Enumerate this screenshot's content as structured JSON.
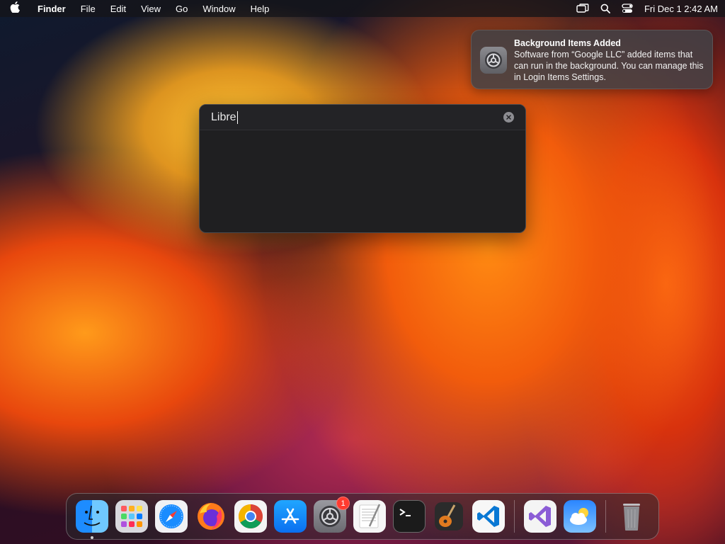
{
  "menubar": {
    "app_name": "Finder",
    "menus": [
      "File",
      "Edit",
      "View",
      "Go",
      "Window",
      "Help"
    ],
    "clock": "Fri Dec 1  2:42 AM"
  },
  "notification": {
    "title": "Background Items Added",
    "body": "Software from “Google LLC” added items that can run in the background. You can manage this in Login Items Settings.",
    "icon": "settings-gear-icon"
  },
  "spotlight": {
    "query": "Libre"
  },
  "dock": {
    "items": [
      {
        "id": "finder",
        "icon": "finder-icon",
        "running": true
      },
      {
        "id": "launchpad",
        "icon": "launchpad-icon"
      },
      {
        "id": "safari",
        "icon": "safari-icon"
      },
      {
        "id": "firefox",
        "icon": "firefox-icon"
      },
      {
        "id": "chrome",
        "icon": "chrome-icon"
      },
      {
        "id": "app-store",
        "icon": "app-store-icon"
      },
      {
        "id": "system-settings",
        "icon": "settings-gear-icon",
        "badge": "1"
      },
      {
        "id": "textedit",
        "icon": "textedit-icon"
      },
      {
        "id": "terminal",
        "icon": "terminal-icon"
      },
      {
        "id": "garageband",
        "icon": "garageband-icon"
      },
      {
        "id": "vscode",
        "icon": "vscode-icon"
      },
      {
        "id": "visual-studio",
        "icon": "visual-studio-icon"
      },
      {
        "id": "weather",
        "icon": "weather-icon"
      },
      {
        "id": "trash",
        "icon": "trash-icon"
      }
    ]
  },
  "colors": {
    "badge": "#ff3b30",
    "menubar_bg": "#141418",
    "spotlight_bg": "#1f1f21"
  }
}
